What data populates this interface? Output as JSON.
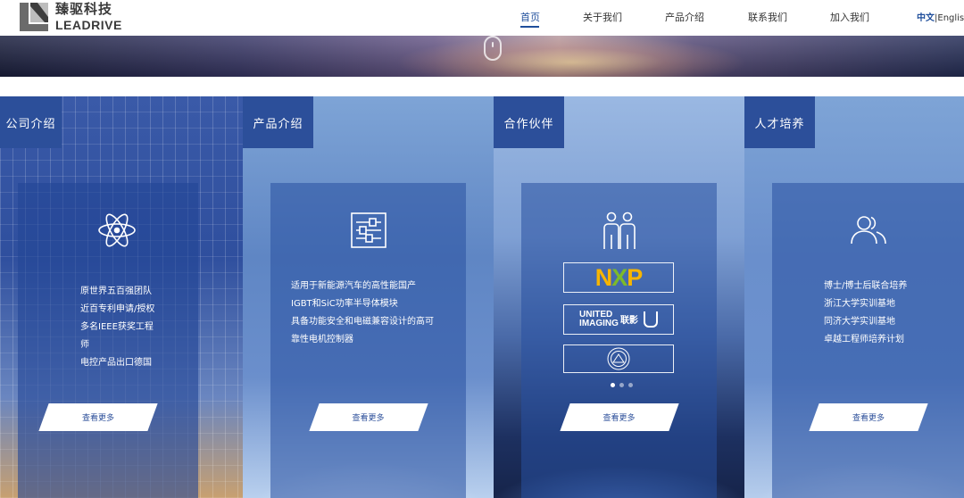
{
  "brand": {
    "name_cn": "臻驱科技",
    "name_en": "LEADRIVE"
  },
  "nav": {
    "items": [
      {
        "label": "首页",
        "active": true
      },
      {
        "label": "关于我们",
        "active": false
      },
      {
        "label": "产品介绍",
        "active": false
      },
      {
        "label": "联系我们",
        "active": false
      },
      {
        "label": "加入我们",
        "active": false
      }
    ],
    "lang": {
      "zh": "中文",
      "sep": "|",
      "en": "English"
    }
  },
  "hero": {
    "scroll_icon": "mouse-scroll-icon"
  },
  "panels": [
    {
      "tab": "公司介绍",
      "icon": "atom-icon",
      "features": [
        "原世界五百强团队",
        "近百专利申请/授权",
        "多名IEEE获奖工程",
        "师",
        "电控产品出口德国"
      ],
      "button": "查看更多"
    },
    {
      "tab": "产品介绍",
      "icon": "sliders-panel-icon",
      "features": [
        "适用于新能源汽车的高性能国产",
        "IGBT和SiC功率半导体模块",
        "具备功能安全和电磁兼容设计的高可",
        "靠性电机控制器"
      ],
      "button": "查看更多"
    },
    {
      "tab": "合作伙伴",
      "icon": "partners-icon",
      "partners": {
        "nxp": [
          "N",
          "X",
          "P"
        ],
        "united_imaging": [
          "UNITED",
          "IMAGING"
        ],
        "united_imaging_cn": "联影",
        "seal": "university-seal-icon"
      },
      "carousel": {
        "count": 3,
        "active": 1
      },
      "button": "查看更多"
    },
    {
      "tab": "人才培养",
      "icon": "people-icon",
      "features": [
        "博士/博士后联合培养",
        "浙江大学实训基地",
        "同济大学实训基地",
        "卓越工程师培养计划"
      ],
      "button": "查看更多"
    }
  ],
  "colors": {
    "brand_blue": "#2c4f9a",
    "nav_active": "#1f4e9b",
    "nxp_yellow": "#f7b500",
    "nxp_green": "#7dba2a"
  }
}
